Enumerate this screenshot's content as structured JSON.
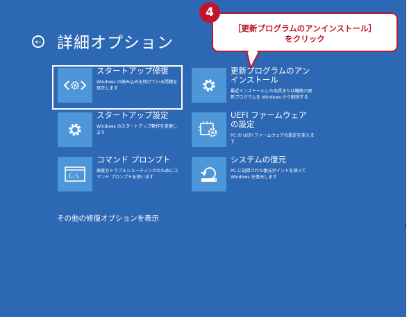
{
  "header": {
    "back_icon": "back-arrow-circle-icon",
    "title": "詳細オプション"
  },
  "options": [
    {
      "title": "スタートアップ修復",
      "description": "Windows の読み込みを妨げている問題を修正します",
      "icon": "startup-repair-icon",
      "selected": true
    },
    {
      "title": "更新プログラムのアンインストール",
      "description": "最近インストールした品質または機能の更新プログラムを Windows から削除する",
      "icon": "gear-icon",
      "selected": false
    },
    {
      "title": "スタートアップ設定",
      "description": "Windows のスタートアップ動作を変更します",
      "icon": "gear-icon",
      "selected": false
    },
    {
      "title": "UEFI ファームウェアの設定",
      "description": "PC の UEFI ファームウェアの設定を変えます",
      "icon": "firmware-chip-gear-icon",
      "selected": false
    },
    {
      "title": "コマンド プロンプト",
      "description": "高度なトラブルシューティングのためにコマンド プロンプトを使います",
      "icon": "command-prompt-icon",
      "selected": false
    },
    {
      "title": "システムの復元",
      "description": "PC に記録された復元ポイントを使って Windows を復元します",
      "icon": "system-restore-icon",
      "selected": false
    }
  ],
  "more_options_link": "その他の修復オプションを表示",
  "callout": {
    "step_number": "4",
    "line1": "［更新プログラムのアンインストール］",
    "line2": "をクリック"
  },
  "colors": {
    "background": "#2d68b4",
    "tile_icon": "#4d97d8",
    "callout_red": "#c0152a"
  }
}
